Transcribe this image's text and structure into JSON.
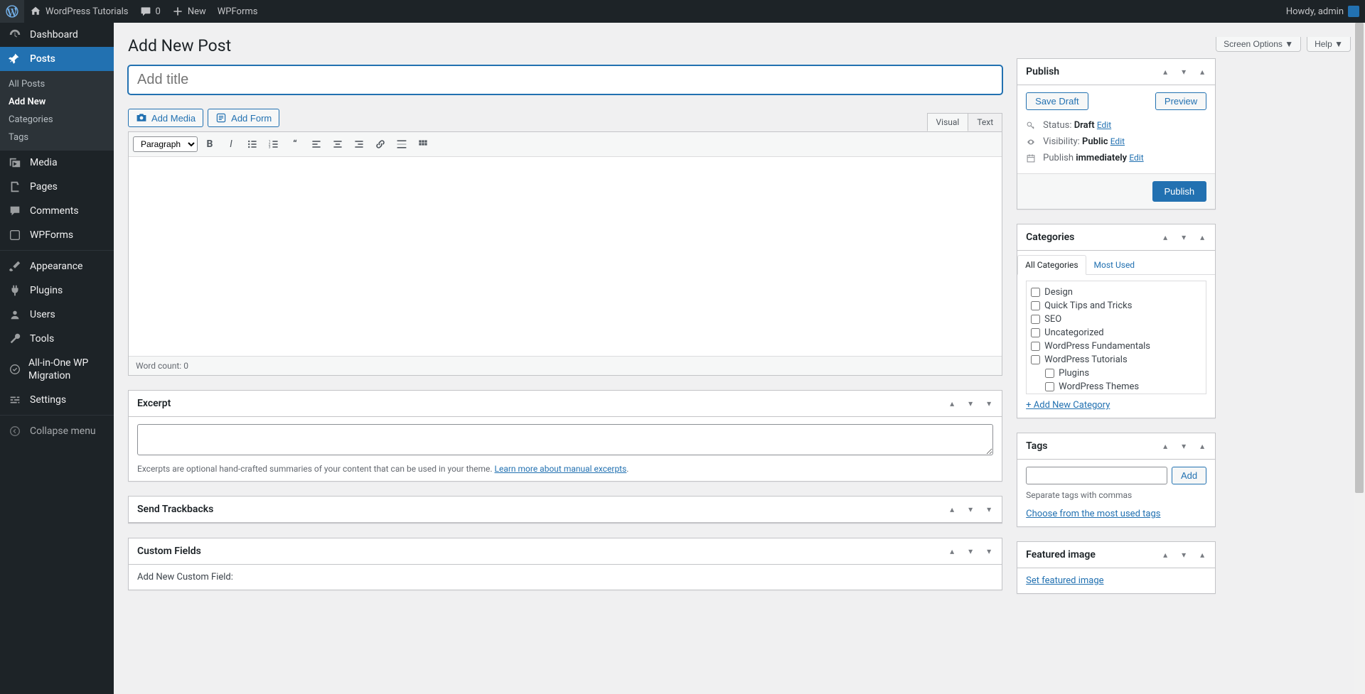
{
  "adminbar": {
    "site_name": "WordPress Tutorials",
    "comment_count": "0",
    "new_label": "New",
    "wpforms": "WPForms",
    "howdy": "Howdy, admin"
  },
  "sidebar": {
    "dashboard": "Dashboard",
    "posts": "Posts",
    "posts_sub": {
      "all": "All Posts",
      "add": "Add New",
      "categories": "Categories",
      "tags": "Tags"
    },
    "media": "Media",
    "pages": "Pages",
    "comments": "Comments",
    "wpforms": "WPForms",
    "appearance": "Appearance",
    "plugins": "Plugins",
    "users": "Users",
    "tools": "Tools",
    "migration": "All-in-One WP Migration",
    "settings": "Settings",
    "collapse": "Collapse menu"
  },
  "top": {
    "screen_options": "Screen Options",
    "help": "Help"
  },
  "page_title": "Add New Post",
  "title_placeholder": "Add title",
  "media_buttons": {
    "add_media": "Add Media",
    "add_form": "Add Form"
  },
  "editor_tabs": {
    "visual": "Visual",
    "text": "Text"
  },
  "toolbar": {
    "paragraph": "Paragraph"
  },
  "word_count_label": "Word count: ",
  "word_count_value": "0",
  "excerpt": {
    "title": "Excerpt",
    "help_pre": "Excerpts are optional hand-crafted summaries of your content that can be used in your theme. ",
    "help_link": "Learn more about manual excerpts"
  },
  "trackbacks": {
    "title": "Send Trackbacks"
  },
  "custom_fields": {
    "title": "Custom Fields",
    "add_label": "Add New Custom Field:"
  },
  "publish": {
    "title": "Publish",
    "save_draft": "Save Draft",
    "preview": "Preview",
    "status_label": "Status: ",
    "status_value": "Draft",
    "visibility_label": "Visibility: ",
    "visibility_value": "Public",
    "publish_label": "Publish ",
    "publish_value": "immediately",
    "edit": "Edit",
    "publish_btn": "Publish"
  },
  "categories": {
    "title": "Categories",
    "tab_all": "All Categories",
    "tab_most": "Most Used",
    "items": [
      {
        "label": "Design",
        "indent": false
      },
      {
        "label": "Quick Tips and Tricks",
        "indent": false
      },
      {
        "label": "SEO",
        "indent": false
      },
      {
        "label": "Uncategorized",
        "indent": false
      },
      {
        "label": "WordPress Fundamentals",
        "indent": false
      },
      {
        "label": "WordPress Tutorials",
        "indent": false
      },
      {
        "label": "Plugins",
        "indent": true
      },
      {
        "label": "WordPress Themes",
        "indent": true
      }
    ],
    "add_new": "+ Add New Category"
  },
  "tags": {
    "title": "Tags",
    "add": "Add",
    "help": "Separate tags with commas",
    "choose": "Choose from the most used tags"
  },
  "featured": {
    "title": "Featured image",
    "link": "Set featured image"
  }
}
